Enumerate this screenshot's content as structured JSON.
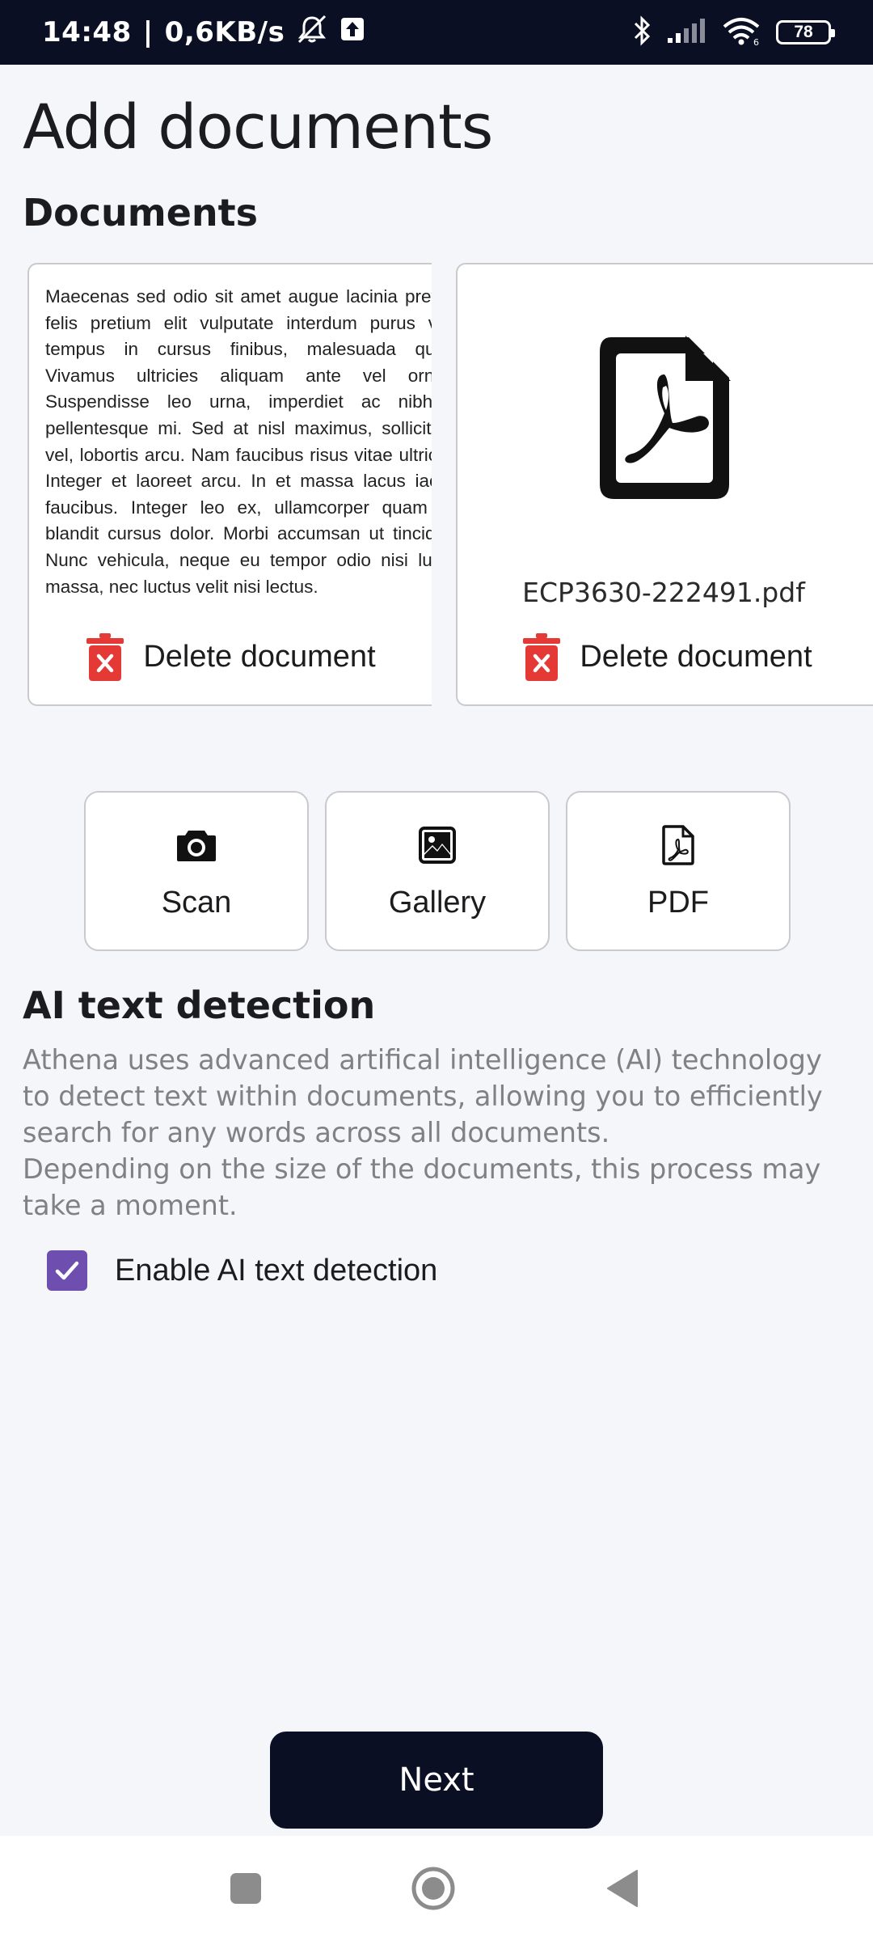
{
  "status_bar": {
    "time": "14:48",
    "separator": "|",
    "net_speed": "0,6KB/s",
    "battery_level": "78",
    "icons": [
      "mute-bell-icon",
      "upload-icon",
      "bluetooth-icon",
      "signal-icon",
      "wifi-icon",
      "battery-icon"
    ]
  },
  "page": {
    "title": "Add documents"
  },
  "documents": {
    "section_title": "Documents",
    "items": [
      {
        "preview_text": "Maecenas sed odio sit amet augue lacinia pretium felis pretium elit vulputate interdum purus velit, tempus in cursus finibus, malesuada quam. Vivamus ultricies aliquam ante vel ornare. Suspendisse leo urna, imperdiet ac nibh et pellentesque mi. Sed at nisl maximus, sollicitudin vel, lobortis arcu. Nam faucibus risus vitae ultricies. Integer et laoreet arcu. In et massa lacus iaculis faucibus. Integer leo ex, ullamcorper quam eu, blandit cursus dolor. Morbi accumsan ut tincidunt. Nunc vehicula, neque eu tempor odio nisi luctus massa, nec luctus velit nisi lectus.",
        "delete_label": "Delete document"
      },
      {
        "file_name": "ECP3630-222491.pdf",
        "delete_label": "Delete document"
      }
    ]
  },
  "actions": [
    {
      "label": "Scan",
      "icon": "camera-icon"
    },
    {
      "label": "Gallery",
      "icon": "image-icon"
    },
    {
      "label": "PDF",
      "icon": "pdf-file-icon"
    }
  ],
  "ai": {
    "title": "AI text detection",
    "description_1": "Athena uses advanced artifical intelligence (AI) technology to detect text within documents, allowing you to efficiently search for any words across all documents.",
    "description_2": "Depending on the size of the documents, this process may take a moment.",
    "checkbox_label": "Enable AI text detection",
    "checkbox_checked": true
  },
  "footer": {
    "next_label": "Next"
  },
  "colors": {
    "dark": "#0b0f24",
    "accent": "#6e4fb0",
    "delete_red": "#e53935",
    "muted_text": "#808085"
  }
}
